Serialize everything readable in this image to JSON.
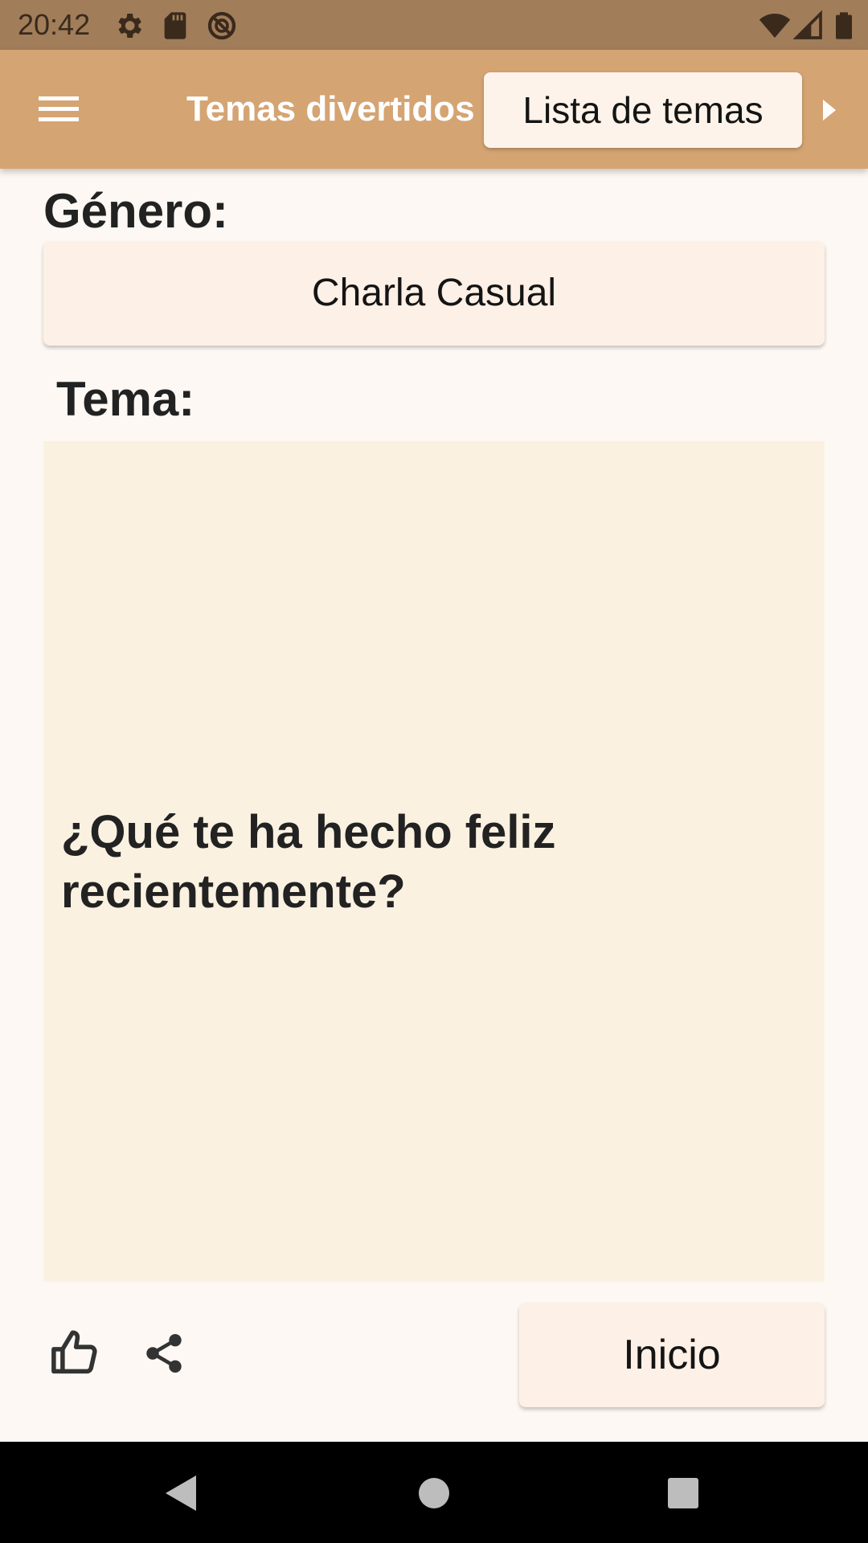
{
  "status_bar": {
    "time": "20:42",
    "icons": [
      "gear-icon",
      "sd-card-icon",
      "no-disturb-icon",
      "wifi-icon",
      "signal-icon",
      "battery-icon"
    ]
  },
  "app_bar": {
    "title": "Temas divertidos",
    "topic_list_button": "Lista de temas",
    "icons": [
      "menu-icon",
      "arrow-right-icon"
    ]
  },
  "genre": {
    "label": "Género:",
    "value": "Charla Casual"
  },
  "topic": {
    "label": "Tema:",
    "text": "¿Qué te ha hecho feliz recientemente?"
  },
  "actions": {
    "start_button": "Inicio",
    "icons": [
      "thumbs-up-icon",
      "share-icon"
    ]
  },
  "nav_bar": {
    "icons": [
      "back-icon",
      "home-icon",
      "recents-icon"
    ]
  },
  "colors": {
    "status_bar": "#A17D5A",
    "app_bar": "#D5A473",
    "background": "#FDF8F3",
    "button": "#FDF0E6",
    "topic_card": "#FAF1E1"
  }
}
